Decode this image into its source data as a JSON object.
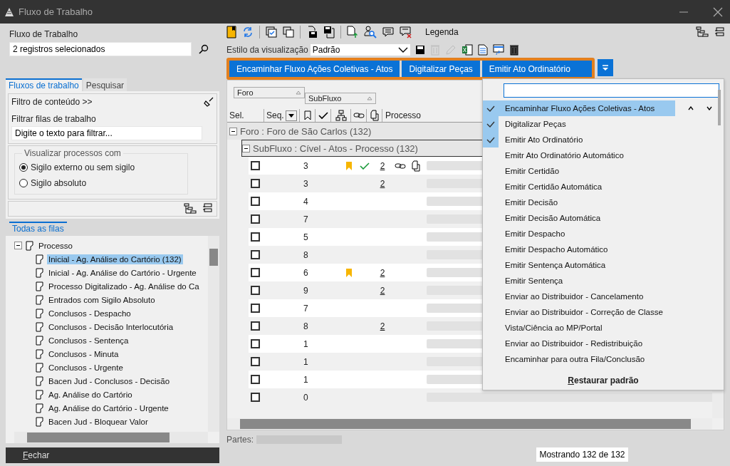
{
  "window": {
    "title": "Fluxo de Trabalho"
  },
  "left": {
    "field_label": "Fluxo de Trabalho",
    "field_value": "2 registros selecionados",
    "tabs": [
      {
        "label": "Fluxos de trabalho",
        "selected": true
      },
      {
        "label": "Pesquisar",
        "selected": false
      }
    ],
    "content_filter": "Filtro de conteúdo >>",
    "filter_label": "Filtrar filas de trabalho",
    "filter_placeholder": "Digite o texto para filtrar...",
    "visibility": {
      "legend": "Visualizar processos com",
      "options": [
        {
          "label": "Sigilo externo ou sem sigilo",
          "selected": true
        },
        {
          "label": "Sigilo absoluto",
          "selected": false
        }
      ]
    },
    "queue_tab": "Todas as filas",
    "tree": [
      {
        "label": "Processo",
        "expanded": true,
        "selected": false,
        "children": [
          {
            "label": "Inicial - Ag. Análise do Cartório (132)",
            "selected": true
          },
          {
            "label": "Inicial - Ag. Análise do Cartório - Urgente",
            "selected": false
          },
          {
            "label": "Processo Digitalizado - Ag. Análise do Ca",
            "selected": false
          },
          {
            "label": "Entrados com Sigilo Absoluto",
            "selected": false
          },
          {
            "label": "Conclusos - Despacho",
            "selected": false
          },
          {
            "label": "Conclusos - Decisão Interlocutória",
            "selected": false
          },
          {
            "label": "Conclusos - Sentença",
            "selected": false
          },
          {
            "label": "Conclusos - Minuta",
            "selected": false
          },
          {
            "label": "Conclusos - Urgente",
            "selected": false
          },
          {
            "label": "Bacen Jud - Conclusos - Decisão",
            "selected": false
          },
          {
            "label": "Ag. Análise do Cartório",
            "selected": false
          },
          {
            "label": "Ag. Análise do Cartório - Urgente",
            "selected": false
          },
          {
            "label": "Bacen Jud - Bloquear Valor",
            "selected": false
          }
        ]
      }
    ],
    "close_button": "Fechar"
  },
  "toolbar": {
    "legend_button": "Legenda"
  },
  "view_style": {
    "label": "Estilo da visualização",
    "value": "Padrão"
  },
  "actions": [
    "Encaminhar Fluxo Ações Coletivas - Atos",
    "Digitalizar Peças",
    "Emitir Ato Ordinatório"
  ],
  "grid": {
    "group_chips": [
      "Foro",
      "SubFluxo"
    ],
    "columns": {
      "sel": "Sel.",
      "seq": "Seq.",
      "process": "Processo"
    },
    "group_row": "Foro : Foro de São Carlos  (132)",
    "subgroup_row": "SubFluxo : Cível - Atos - Processo  (132)",
    "rows": [
      {
        "checked": false,
        "seq": "3",
        "bookmarked": true,
        "confirmed": true,
        "count": "2",
        "linked": true,
        "attached": true
      },
      {
        "checked": false,
        "seq": "3",
        "bookmarked": false,
        "confirmed": false,
        "count": "2",
        "linked": false,
        "attached": false
      },
      {
        "checked": false,
        "seq": "4",
        "bookmarked": false,
        "confirmed": false,
        "linked": false,
        "attached": false
      },
      {
        "checked": false,
        "seq": "7",
        "bookmarked": false,
        "confirmed": false,
        "linked": false,
        "attached": false
      },
      {
        "checked": false,
        "seq": "5",
        "bookmarked": false,
        "confirmed": false,
        "linked": false,
        "attached": false
      },
      {
        "checked": false,
        "seq": "8",
        "bookmarked": false,
        "confirmed": false,
        "linked": false,
        "attached": false
      },
      {
        "checked": false,
        "seq": "6",
        "bookmarked": true,
        "confirmed": false,
        "count": "2",
        "linked": false,
        "attached": false
      },
      {
        "checked": false,
        "seq": "9",
        "bookmarked": false,
        "confirmed": false,
        "count": "2",
        "linked": false,
        "attached": false
      },
      {
        "checked": false,
        "seq": "7",
        "bookmarked": false,
        "confirmed": false,
        "linked": false,
        "attached": false
      },
      {
        "checked": false,
        "seq": "8",
        "bookmarked": false,
        "confirmed": false,
        "count": "2",
        "linked": false,
        "attached": false
      },
      {
        "checked": false,
        "seq": "1",
        "bookmarked": false,
        "confirmed": false,
        "linked": false,
        "attached": false
      },
      {
        "checked": false,
        "seq": "1",
        "bookmarked": false,
        "confirmed": false,
        "linked": false,
        "attached": false
      },
      {
        "checked": false,
        "seq": "1",
        "bookmarked": false,
        "confirmed": false,
        "linked": false,
        "attached": false
      },
      {
        "checked": false,
        "seq": "0",
        "bookmarked": false,
        "confirmed": false,
        "linked": false,
        "attached": false
      }
    ]
  },
  "action_menu": {
    "items": [
      {
        "label": "Encaminhar Fluxo Ações Coletivas - Atos",
        "checked": true,
        "highlighted": true
      },
      {
        "label": "Digitalizar Peças",
        "checked": true,
        "highlighted": false
      },
      {
        "label": "Emitir Ato Ordinatório",
        "checked": true,
        "highlighted": false
      },
      {
        "label": "Emitr Ato Ordinatório Automático",
        "checked": false,
        "highlighted": false
      },
      {
        "label": "Emitir Certidão",
        "checked": false,
        "highlighted": false
      },
      {
        "label": "Emitir Certidão Automática",
        "checked": false,
        "highlighted": false
      },
      {
        "label": "Emitir Decisão",
        "checked": false,
        "highlighted": false
      },
      {
        "label": "Emitir Decisão Automática",
        "checked": false,
        "highlighted": false
      },
      {
        "label": "Emitir Despacho",
        "checked": false,
        "highlighted": false
      },
      {
        "label": "Emitir Despacho Automático",
        "checked": false,
        "highlighted": false
      },
      {
        "label": "Emitir Sentença Automática",
        "checked": false,
        "highlighted": false
      },
      {
        "label": "Emitir Sentença",
        "checked": false,
        "highlighted": false
      },
      {
        "label": "Enviar ao Distribuidor - Cancelamento",
        "checked": false,
        "highlighted": false
      },
      {
        "label": "Enviar ao Distribuidor - Correção de Classe",
        "checked": false,
        "highlighted": false
      },
      {
        "label": "Vista/Ciência ao MP/Portal",
        "checked": false,
        "highlighted": false
      },
      {
        "label": "Enviar ao Distribuidor - Redistribuição",
        "checked": false,
        "highlighted": false
      },
      {
        "label": "Encaminhar para outra Fila/Conclusão",
        "checked": false,
        "highlighted": false
      }
    ],
    "restore_button": "Restaurar padrão"
  },
  "footer": {
    "parts_label": "Partes:",
    "status": "Mostrando 132 de 132"
  }
}
